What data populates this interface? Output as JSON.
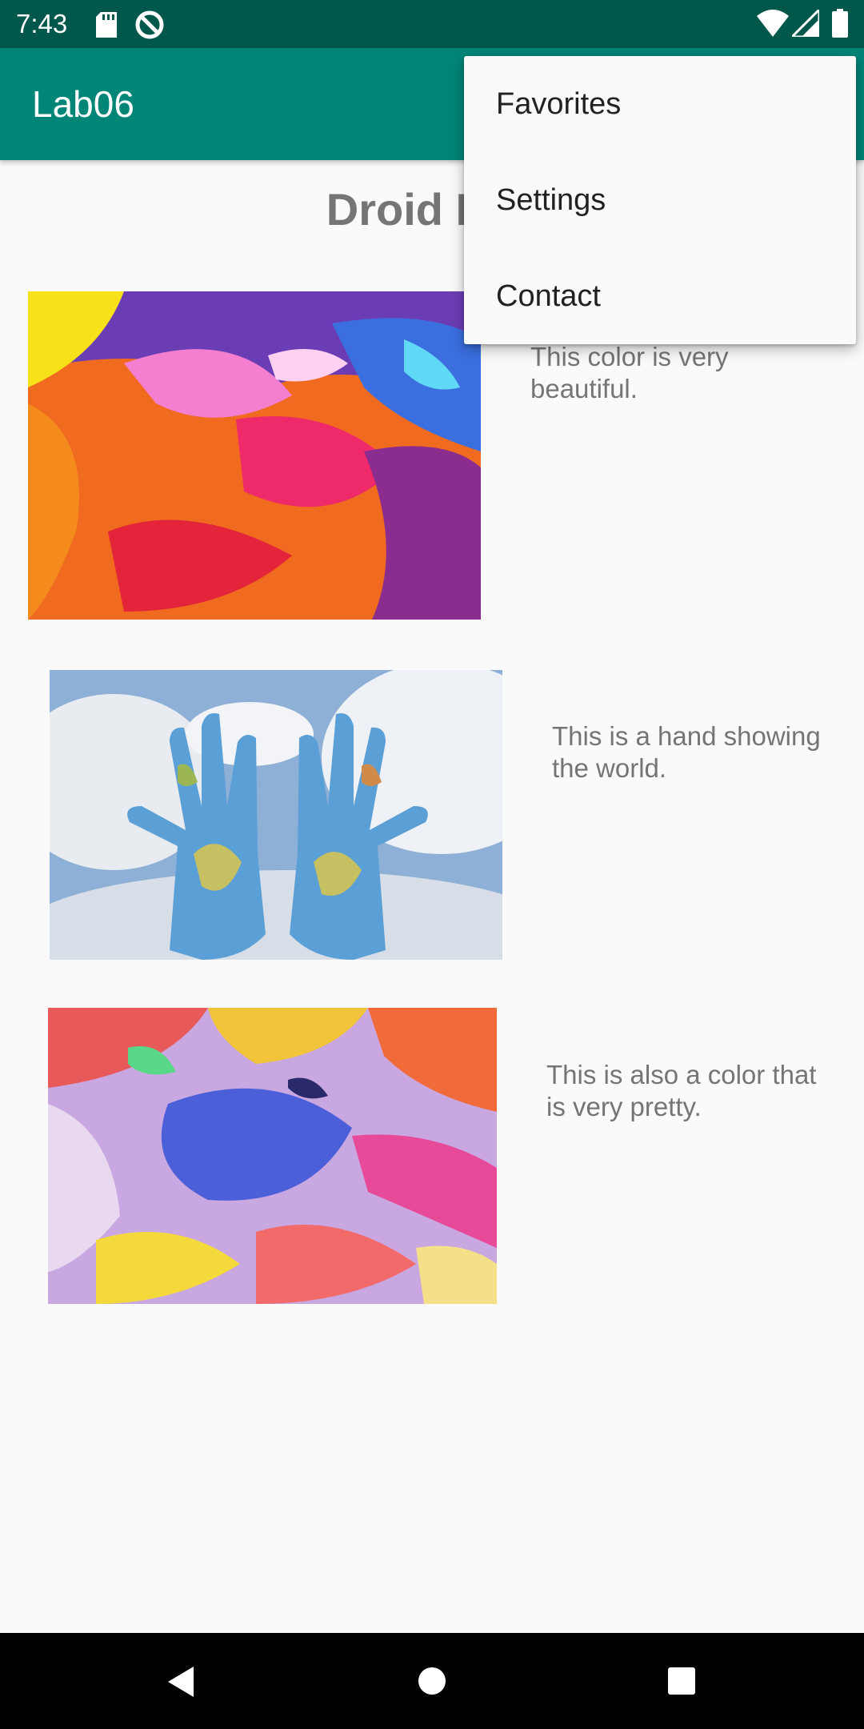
{
  "status_bar": {
    "time": "7:43",
    "icons": [
      "sd-card-icon",
      "sync-icon",
      "wifi-icon",
      "signal-icon",
      "battery-icon"
    ]
  },
  "app_bar": {
    "title": "Lab06",
    "color": "#008577",
    "status_color": "#00574b"
  },
  "main": {
    "heading": "Droid Des",
    "items": [
      {
        "caption": "This color is very beautiful.",
        "image": "colorful-paint-image"
      },
      {
        "caption": "This is a hand showing the world.",
        "image": "world-hands-image"
      },
      {
        "caption": "This is also a color that is very pretty.",
        "image": "color-splash-image"
      }
    ]
  },
  "overflow_menu": {
    "items": [
      {
        "label": "Favorites"
      },
      {
        "label": "Settings"
      },
      {
        "label": "Contact"
      }
    ]
  },
  "nav_bar": {
    "icons": [
      "back-icon",
      "home-icon",
      "recents-icon"
    ]
  }
}
